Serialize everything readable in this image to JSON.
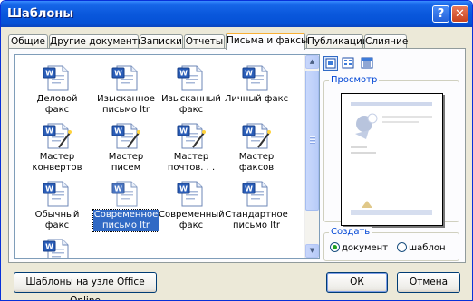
{
  "window": {
    "title": "Шаблоны",
    "help_label": "?",
    "close_label": "✕"
  },
  "tabs": [
    {
      "label": "Общие",
      "active": false
    },
    {
      "label": "Другие документы",
      "active": false
    },
    {
      "label": "Записки",
      "active": false
    },
    {
      "label": "Отчеты",
      "active": false
    },
    {
      "label": "Письма и факсы",
      "active": true
    },
    {
      "label": "Публикации",
      "active": false
    },
    {
      "label": "Слияние",
      "active": false
    }
  ],
  "templates": [
    {
      "label": "Деловой\nфакс",
      "icon": "word-template-icon",
      "selected": false
    },
    {
      "label": "Изысканное\nписьмо ltr",
      "icon": "word-template-icon",
      "selected": false
    },
    {
      "label": "Изысканный\nфакс",
      "icon": "word-template-icon",
      "selected": false
    },
    {
      "label": "Личный факс",
      "icon": "word-template-icon",
      "selected": false
    },
    {
      "label": "Мастер\nконвертов",
      "icon": "word-wizard-icon",
      "selected": false
    },
    {
      "label": "Мастер писем",
      "icon": "word-wizard-icon",
      "selected": false
    },
    {
      "label": "Мастер\nпочтов. . .",
      "icon": "word-wizard-icon",
      "selected": false
    },
    {
      "label": "Мастер\nфаксов",
      "icon": "word-wizard-icon",
      "selected": false
    },
    {
      "label": "Обычный\nфакс",
      "icon": "word-template-icon",
      "selected": false
    },
    {
      "label": "Современное\nписьмо ltr",
      "icon": "word-template-icon",
      "selected": true
    },
    {
      "label": "Современный\nфакс",
      "icon": "word-template-icon",
      "selected": false
    },
    {
      "label": "Стандартное\nписьмо ltr",
      "icon": "word-template-icon",
      "selected": false
    },
    {
      "label": "",
      "icon": "word-template-icon",
      "selected": false
    }
  ],
  "preview": {
    "label": "Просмотр"
  },
  "create": {
    "label": "Создать",
    "options": [
      {
        "label": "документ",
        "checked": true
      },
      {
        "label": "шаблон",
        "checked": false
      }
    ]
  },
  "buttons": {
    "office_online": "Шаблоны на узле Office Online",
    "ok": "ОК",
    "cancel": "Отмена"
  },
  "colors": {
    "title_bar": "#0a58dc",
    "selection": "#316ac5",
    "active_tab_accent": "#f9b036"
  }
}
